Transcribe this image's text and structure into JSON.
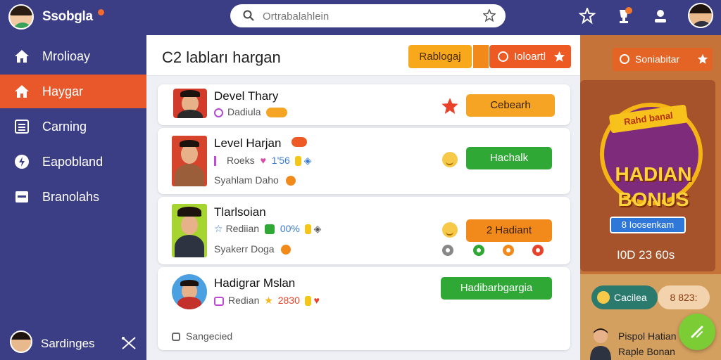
{
  "app": {
    "brand": "Ssobgla",
    "search_placeholder": "Ortrabalahlein"
  },
  "sidebar": {
    "items": [
      {
        "label": "Mrolioay",
        "icon": "home-icon",
        "active": false
      },
      {
        "label": "Haygar",
        "icon": "home-icon",
        "active": true
      },
      {
        "label": "Carning",
        "icon": "list-icon",
        "active": false
      },
      {
        "label": "Eapobland",
        "icon": "bolt-icon",
        "active": false
      },
      {
        "label": "Branolahs",
        "icon": "card-icon",
        "active": false
      }
    ],
    "footer_label": "Sardinges"
  },
  "main": {
    "title": "C2 labları hargan",
    "btn_primary": "Rablogaj",
    "btn_secondary": "Ioloartl",
    "cards": [
      {
        "name": "Devel Thary",
        "line1": "Dadiula",
        "button": "Cebearh"
      },
      {
        "name": "Level Harjan",
        "line1": "Roeks",
        "line1_stat": "1'56",
        "line2": "Syahlam Daho",
        "button": "Hachalk"
      },
      {
        "name": "Tlarlsoian",
        "line1": "Rediian",
        "line1_stat": "00%",
        "line2": "Syakerr Doga",
        "button": "2 Hadiant"
      },
      {
        "name": "Hadigrar Mslan",
        "line1": "Redian",
        "line1_stat": "2830",
        "button": "Hadibarbgargia",
        "footer": "Sangecied"
      }
    ]
  },
  "promo": {
    "top_label": "Soniabitar",
    "ribbon": "Rahd banal",
    "title_line1": "HADIAN",
    "title_line2": "BONUS",
    "sub": "8 Ioosenkam",
    "count": "I0D 23 60s",
    "pill1": "Cacilea",
    "pill2": "8 823:",
    "bottom1": "Pispol Hatian",
    "bottom2": "Raple Bonan"
  },
  "colors": {
    "nav_bg": "#3b3e85",
    "accent": "#e8582b",
    "orange_button": "#f5a523",
    "green_button": "#2fa835"
  }
}
